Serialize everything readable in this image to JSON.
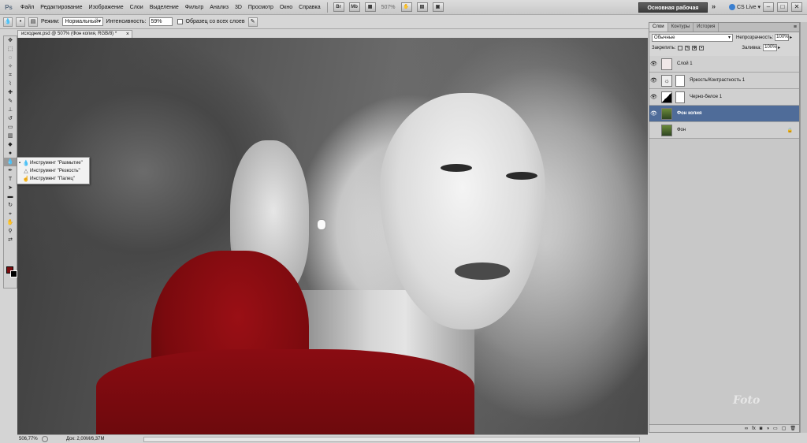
{
  "app": {
    "logo": "Ps",
    "menu": [
      "Файл",
      "Редактирование",
      "Изображение",
      "Слои",
      "Выделение",
      "Фильтр",
      "Анализ",
      "3D",
      "Просмотр",
      "Окно",
      "Справка"
    ],
    "zoom_display": "507%",
    "workspace_button": "Основная рабочая среда",
    "more_chevron": "»",
    "cs_live": "CS Live ▾",
    "window_controls": [
      "–",
      "□",
      "✕"
    ]
  },
  "options": {
    "mode_label": "Режим:",
    "mode_value": "Нормальный",
    "strength_label": "Интенсивность:",
    "strength_value": "59%",
    "sample_all_label": "Образец со всех слоев"
  },
  "document": {
    "tab_title": "исходник.psd @ 507% (Фон копия, RGB/8) *",
    "close": "×"
  },
  "tool_flyout": [
    {
      "label": "Инструмент \"Размытие\"",
      "icon": "drop-icon",
      "selected": true
    },
    {
      "label": "Инструмент \"Резкость\"",
      "icon": "triangle-icon",
      "selected": false
    },
    {
      "label": "Инструмент \"Палец\"",
      "icon": "finger-icon",
      "selected": false
    }
  ],
  "status": {
    "zoom": "506,77%",
    "doc_info": "Док: 2,00M/6,37M"
  },
  "layers_panel": {
    "tabs": [
      "Слои",
      "Контуры",
      "История"
    ],
    "blend_mode": "Обычные",
    "opacity_label": "Непрозрачность:",
    "opacity_value": "100%",
    "lock_label": "Закрепить:",
    "fill_label": "Заливка:",
    "fill_value": "100%",
    "layers": [
      {
        "name": "Слой 1",
        "visible": true,
        "thumb": "#f0e8e8",
        "mask": false,
        "selected": false,
        "locked": false
      },
      {
        "name": "Яркость/Контрастность 1",
        "visible": true,
        "thumb": "#eeeeee",
        "mask": true,
        "selected": false,
        "locked": false
      },
      {
        "name": "Черно-белое 1",
        "visible": true,
        "thumb": "#808080",
        "mask": true,
        "selected": false,
        "locked": false
      },
      {
        "name": "Фон копия",
        "visible": true,
        "thumb": "#3e5c2e",
        "mask": false,
        "selected": true,
        "locked": false
      },
      {
        "name": "Фон",
        "visible": false,
        "thumb": "#3e5c2e",
        "mask": false,
        "selected": false,
        "locked": true
      }
    ]
  },
  "watermark": "Foto"
}
